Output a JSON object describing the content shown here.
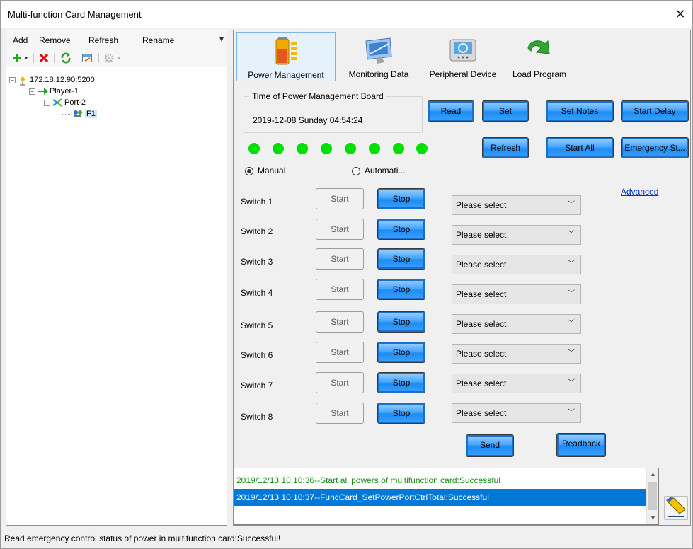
{
  "window": {
    "title": "Multi-function Card Management",
    "close_glyph": "✕"
  },
  "left": {
    "menu": [
      "Add",
      "Remove",
      "Refresh",
      "Rename"
    ],
    "menu_overflow": "▾",
    "toolbar_icons": [
      "add-icon",
      "delete-icon",
      "refresh-icon",
      "rename-icon",
      "settings-icon"
    ],
    "tree": {
      "root": "172.18.12.90:5200",
      "player": "Player-1",
      "port": "Port-2",
      "card": "F1"
    }
  },
  "tabs": [
    {
      "label": "Power Management",
      "icon": "power-battery-icon",
      "active": true
    },
    {
      "label": "Monitoring Data",
      "icon": "monitor-icon",
      "active": false
    },
    {
      "label": "Peripheral Device",
      "icon": "peripheral-device-icon",
      "active": false
    },
    {
      "label": "Load Program",
      "icon": "load-arrow-icon",
      "active": false
    }
  ],
  "power": {
    "time_group_title": "Time of Power Management Board",
    "time_value": "2019-12-08 Sunday 04:54:24",
    "buttons": {
      "read": "Read",
      "set": "Set",
      "set_notes": "Set Notes",
      "start_delay": "Start Delay",
      "refresh": "Refresh",
      "start_all": "Start All",
      "emergency": "Emergency St..."
    },
    "leds_on": 8,
    "mode": {
      "manual": "Manual",
      "auto": "Automati...",
      "selected": "manual"
    },
    "advanced": "Advanced",
    "switches": [
      {
        "label": "Switch 1",
        "start": "Start",
        "stop": "Stop",
        "select": "Please select"
      },
      {
        "label": "Switch 2",
        "start": "Start",
        "stop": "Stop",
        "select": "Please select"
      },
      {
        "label": "Switch 3",
        "start": "Start",
        "stop": "Stop",
        "select": "Please select"
      },
      {
        "label": "Switch 4",
        "start": "Start",
        "stop": "Stop",
        "select": "Please select"
      },
      {
        "label": "Switch 5",
        "start": "Start",
        "stop": "Stop",
        "select": "Please select"
      },
      {
        "label": "Switch 6",
        "start": "Start",
        "stop": "Stop",
        "select": "Please select"
      },
      {
        "label": "Switch 7",
        "start": "Start",
        "stop": "Stop",
        "select": "Please select"
      },
      {
        "label": "Switch 8",
        "start": "Start",
        "stop": "Stop",
        "select": "Please select"
      }
    ],
    "send": "Send",
    "readback": "Readback"
  },
  "log": [
    {
      "text": "2019/12/13 10:10:36--Start all powers of multifunction card:Successful",
      "selected": false
    },
    {
      "text": "2019/12/13 10:10:37--FuncCard_SetPowerPortCtrlTotal:Successful",
      "selected": true
    }
  ],
  "status": "Read emergency control status of power in multifunction card:Successful!",
  "colors": {
    "accent_blue": "#1e8cf3",
    "led_green": "#00e000",
    "log_success": "#1a8c1a",
    "selection": "#0078d7"
  }
}
